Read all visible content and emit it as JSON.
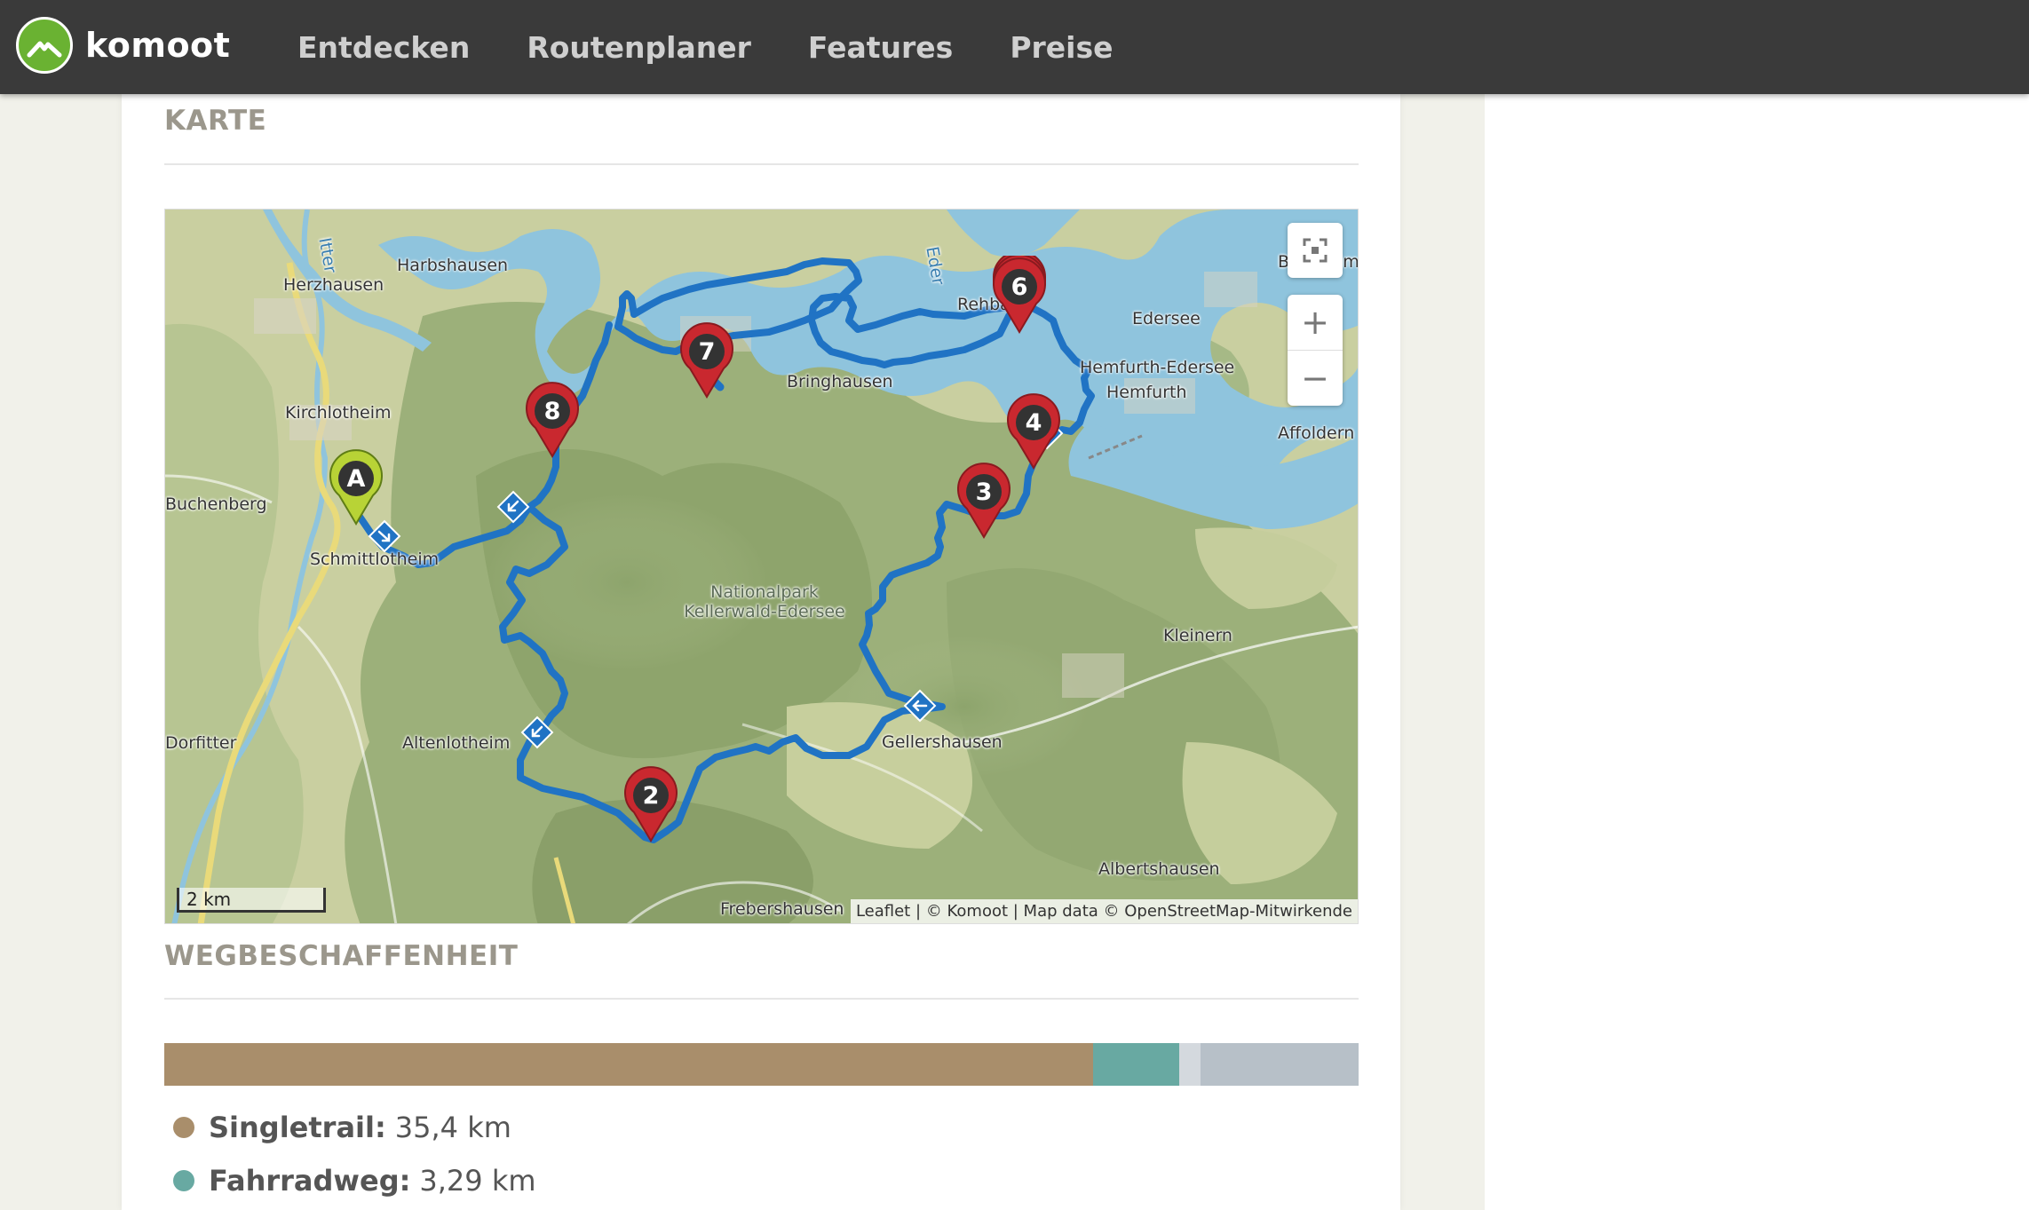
{
  "brand": {
    "name": "komoot",
    "color": "#6ab232"
  },
  "nav": {
    "items": [
      "Entdecken",
      "Routenplaner",
      "Features",
      "Preise"
    ]
  },
  "sections": {
    "map_title": "KARTE",
    "surface_title": "WEGBESCHAFFENHEIT"
  },
  "map": {
    "places": [
      "Harbshausen",
      "Herzhausen",
      "Kirchlotheim",
      "Buchenberg",
      "Schmittlotheim",
      "Bringhausen",
      "Edersee",
      "Hemfurth-Edersee",
      "Hemfurth",
      "Affoldern",
      "Rehbach",
      "Kleinern",
      "Gellershausen",
      "Altenlotheim",
      "Dorfitter",
      "Frebershausen",
      "Albertshausen",
      "Eder",
      "Itter",
      "Bergheim"
    ],
    "park_label": [
      "Nationalpark",
      "Kellerwald-Edersee"
    ],
    "markers": [
      "A",
      "2",
      "3",
      "4",
      "6",
      "7",
      "8"
    ],
    "scale": "2 km",
    "zoom_in": "+",
    "zoom_out": "−",
    "fit_icon": "fit-bounds-icon",
    "attribution": {
      "leaflet": "Leaflet",
      "sep": " | ",
      "komoot": "© Komoot",
      "mapdata": "Map data",
      "osm": "© OpenStreetMap-Mitwirkende"
    }
  },
  "surface": {
    "segments": [
      {
        "name": "Singletrail",
        "fraction": 0.778,
        "color": "#a98e6b"
      },
      {
        "name": "Fahrradweg",
        "fraction": 0.072,
        "color": "#68a9a2"
      },
      {
        "name": "",
        "fraction": 0.018,
        "color": "#d4d9de"
      },
      {
        "name": "",
        "fraction": 0.132,
        "color": "#b7c0c8"
      }
    ],
    "legend": [
      {
        "name": "Singletrail:",
        "value": "35,4 km",
        "color": "#a98e6b"
      },
      {
        "name": "Fahrradweg:",
        "value": "3,29 km",
        "color": "#68a9a2"
      }
    ]
  }
}
